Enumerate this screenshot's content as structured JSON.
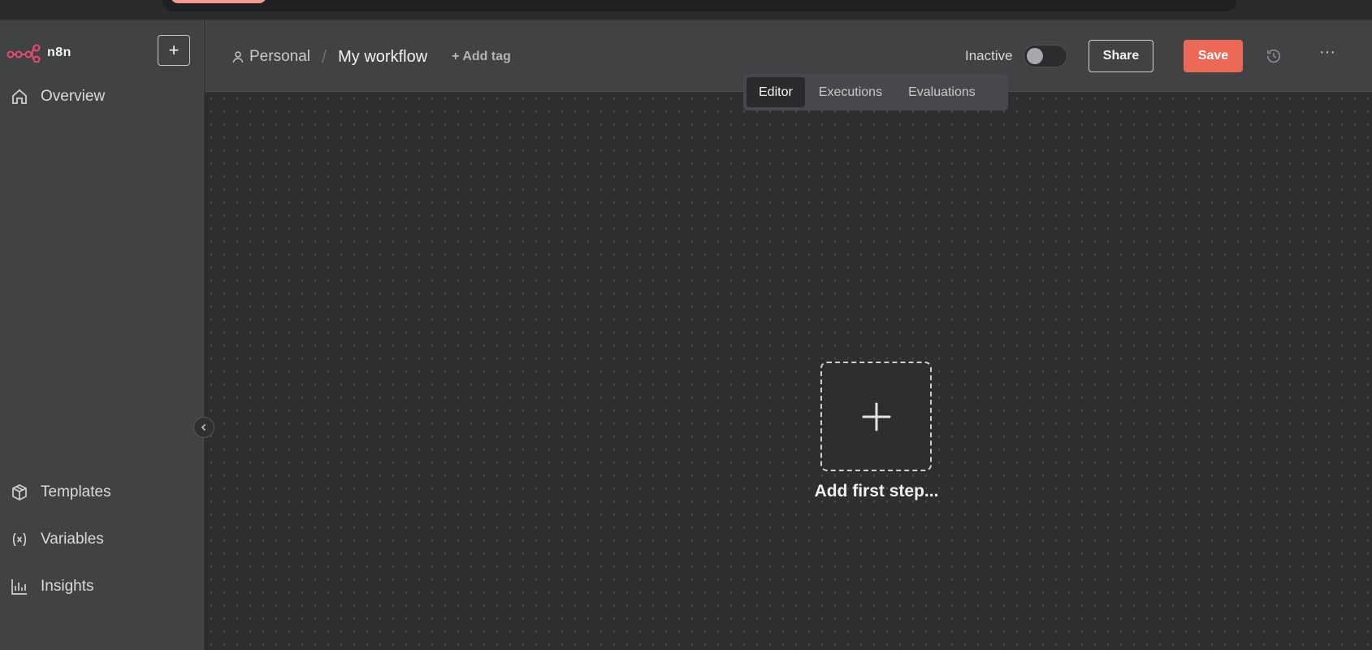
{
  "app": {
    "name": "n8n"
  },
  "sidebar": {
    "items": [
      {
        "label": "Overview",
        "icon": "home-icon"
      },
      {
        "label": "Templates",
        "icon": "box-icon"
      },
      {
        "label": "Variables",
        "icon": "variable-icon"
      },
      {
        "label": "Insights",
        "icon": "chart-icon"
      }
    ],
    "new_button": "+"
  },
  "header": {
    "project": "Personal",
    "separator": "/",
    "workflow_name": "My workflow",
    "add_tag": "+ Add tag",
    "status": "Inactive",
    "share": "Share",
    "save": "Save",
    "more": "···"
  },
  "tabs": [
    {
      "label": "Editor",
      "active": true
    },
    {
      "label": "Executions",
      "active": false
    },
    {
      "label": "Evaluations",
      "active": false
    }
  ],
  "canvas": {
    "add_first_step": "Add first step..."
  },
  "colors": {
    "accent": "#ec6957",
    "logo": "#ea4b71"
  }
}
